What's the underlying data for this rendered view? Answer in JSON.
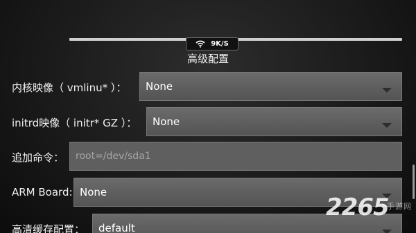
{
  "status": {
    "net_speed": "9K/S",
    "wifi_icon": "wifi-icon",
    "progress_fraction": 1.0
  },
  "section": {
    "title": "高级配置"
  },
  "form": {
    "kernel": {
      "label": "内核映像（ vmlinu* ）：",
      "value": "None"
    },
    "initrd": {
      "label": "initrd映像（ initr* GZ ）：",
      "value": "None"
    },
    "append": {
      "label": "追加命令：",
      "placeholder": "root=/dev/sda1"
    },
    "arm_board": {
      "label": "ARM Board:",
      "value": "None"
    },
    "cache": {
      "label": "高清缓存配置：",
      "value": "default"
    }
  },
  "watermark": {
    "number": "2265",
    "text": "手游网"
  },
  "colors": {
    "background": "#1c1c1c",
    "dropdown": "#5e5e5e",
    "progress": "#cfcfcf"
  }
}
